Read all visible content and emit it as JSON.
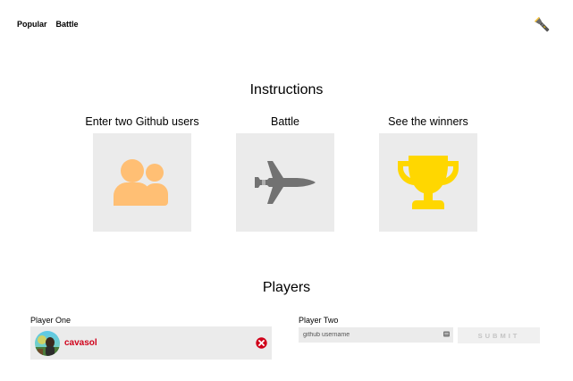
{
  "nav": {
    "links": [
      "Popular",
      "Battle"
    ]
  },
  "theme_icon": "flashlight-icon",
  "instructions": {
    "title": "Instructions",
    "cards": [
      {
        "label": "Enter two Github users",
        "icon": "users-icon",
        "color": "#ffbf74"
      },
      {
        "label": "Battle",
        "icon": "fighter-jet-icon",
        "color": "#727272"
      },
      {
        "label": "See the winners",
        "icon": "trophy-icon",
        "color": "#ffd700"
      }
    ]
  },
  "players": {
    "title": "Players",
    "player_one": {
      "label": "Player One",
      "username": "cavasol",
      "reset_icon": "close-circle-icon",
      "name_color": "#d0021b"
    },
    "player_two": {
      "label": "Player Two",
      "placeholder": "github username",
      "value": "",
      "submit_label": "SUBMIT"
    }
  }
}
